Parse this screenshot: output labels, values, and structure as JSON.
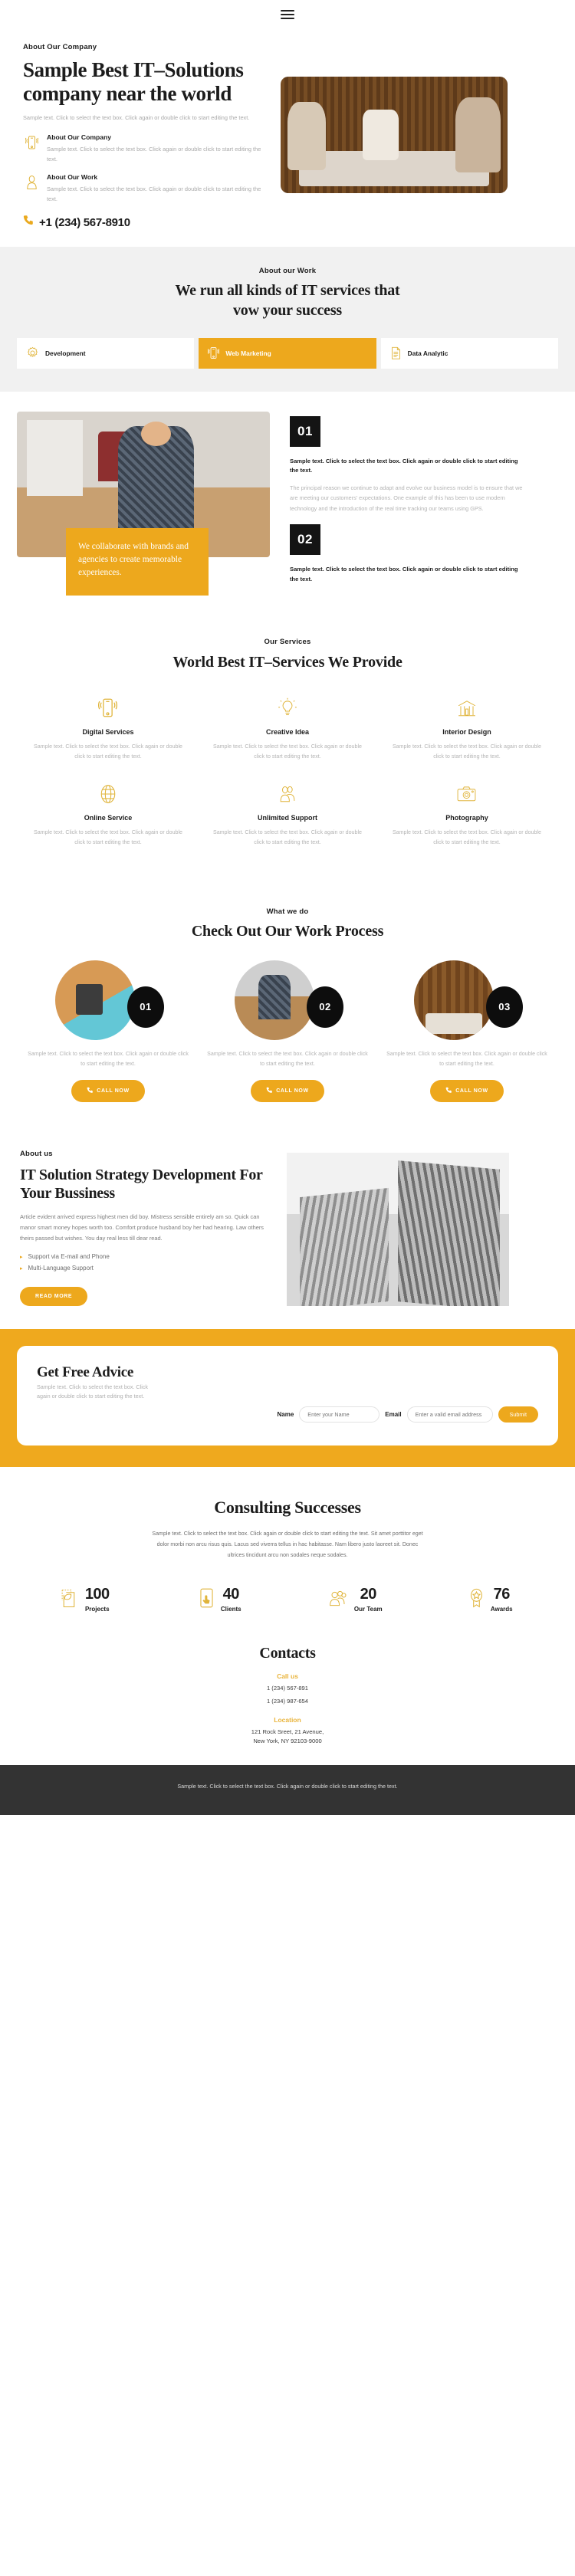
{
  "header": {
    "menu_icon": "hamburger-menu-icon"
  },
  "hero": {
    "eyebrow": "About Our Company",
    "title": "Sample Best IT–Solutions company near the world",
    "paragraph": "Sample text. Click to select the text box. Click again or double click to start editing the text.",
    "features": [
      {
        "icon": "mobile-signal-icon",
        "title": "About Our Company",
        "text": "Sample text. Click to select the text box. Click again or double click to start editing the text."
      },
      {
        "icon": "person-icon",
        "title": "About Our Work",
        "text": "Sample text. Click to select the text box. Click again or double click to start editing the text."
      }
    ],
    "phone_icon": "phone-icon",
    "phone": "+1 (234) 567-8910",
    "image_alt": "business-meeting-photo"
  },
  "work": {
    "eyebrow": "About our Work",
    "title": "We run all kinds of IT services that vow your success",
    "tabs": [
      {
        "label": "Development",
        "icon": "gear-icon",
        "active": false
      },
      {
        "label": "Web Marketing",
        "icon": "mobile-signal-icon",
        "active": true
      },
      {
        "label": "Data Analytic",
        "icon": "document-icon",
        "active": false
      }
    ],
    "active_color": "#eda81d"
  },
  "split": {
    "image_alt": "man-thinking-at-desk-photo",
    "callout": "We collaborate with brands and agencies to create memorable experiences.",
    "callout_bg": "#eda81d",
    "blocks": [
      {
        "number": "01",
        "bold": "Sample text. Click to select the text box. Click again or double click to start editing the text.",
        "body": "The principal reason we continue to adapt and evolve our business model is to ensure that we are meeting our customers’ expectations. One example of this has been to use modern technology and the introduction of the real time tracking our teams using GPS."
      },
      {
        "number": "02",
        "bold": "Sample text. Click to select the text box. Click again or double click to start editing the text.",
        "body": ""
      }
    ]
  },
  "services": {
    "eyebrow": "Our Services",
    "title": "World Best IT–Services We Provide",
    "items": [
      {
        "icon": "mobile-signal-icon",
        "title": "Digital Services",
        "text": "Sample text. Click to select the text box. Click again or double click to start editing the text."
      },
      {
        "icon": "lightbulb-icon",
        "title": "Creative Idea",
        "text": "Sample text. Click to select the text box. Click again or double click to start editing the text."
      },
      {
        "icon": "building-icon",
        "title": "Interior Design",
        "text": "Sample text. Click to select the text box. Click again or double click to start editing the text."
      },
      {
        "icon": "globe-icon",
        "title": "Online Service",
        "text": "Sample text. Click to select the text box. Click again or double click to start editing the text."
      },
      {
        "icon": "people-icon",
        "title": "Unlimited Support",
        "text": "Sample text. Click to select the text box. Click again or double click to start editing the text."
      },
      {
        "icon": "camera-icon",
        "title": "Photography",
        "text": "Sample text. Click to select the text box. Click again or double click to start editing the text."
      }
    ]
  },
  "process": {
    "eyebrow": "What we do",
    "title": "Check Out Our Work Process",
    "steps": [
      {
        "number": "01",
        "image_alt": "calculator-desk-photo",
        "text": "Sample text. Click to select the text box. Click again or double click to start editing the text.",
        "button": "CALL NOW",
        "button_icon": "phone-icon"
      },
      {
        "number": "02",
        "image_alt": "man-with-laptop-photo",
        "text": "Sample text. Click to select the text box. Click again or double click to start editing the text.",
        "button": "CALL NOW",
        "button_icon": "phone-icon"
      },
      {
        "number": "03",
        "image_alt": "office-meeting-photo",
        "text": "Sample text. Click to select the text box. Click again or double click to start editing the text.",
        "button": "CALL NOW",
        "button_icon": "phone-icon"
      }
    ]
  },
  "about": {
    "eyebrow": "About us",
    "title": "IT Solution Strategy Development For Your Bussiness",
    "paragraph": "Article evident arrived express highest men did boy. Mistress sensible entirely am so. Quick can manor smart money hopes worth too. Comfort produce husband boy her had hearing. Law others theirs passed but wishes. You day real less till dear read.",
    "bullets": [
      "Support via E-mail and Phone",
      "Multi-Language Support"
    ],
    "button": "READ MORE",
    "image_alt": "grayscale-skyscraper-photo"
  },
  "advice": {
    "band_bg": "#efa91e",
    "title": "Get Free Advice",
    "subtitle": "Sample text. Click to select the text box. Click again or double click to start editing the text.",
    "name_label": "Name",
    "name_placeholder": "Enter your Name",
    "email_label": "Email",
    "email_placeholder": "Enter a valid email address",
    "submit_label": "Submit"
  },
  "consulting": {
    "title": "Consulting Successes",
    "paragraph": "Sample text. Click to select the text box. Click again or double click to start editing the text. Sit amet porttitor eget dolor morbi non arcu risus quis. Lacus sed viverra tellus in hac habitasse. Nam libero justo laoreet sit. Donec ultrices tincidunt arcu non sodales neque sodales.",
    "stats": [
      {
        "icon": "document-leaf-icon",
        "value": "100",
        "label": "Projects"
      },
      {
        "icon": "mobile-tap-icon",
        "value": "40",
        "label": "Clients"
      },
      {
        "icon": "people-group-icon",
        "value": "20",
        "label": "Our Team"
      },
      {
        "icon": "award-badge-icon",
        "value": "76",
        "label": "Awards"
      }
    ]
  },
  "contacts": {
    "title": "Contacts",
    "call_heading": "Call us",
    "phone1": "1 (234) 567-891",
    "phone2": "1 (234) 987-654",
    "location_heading": "Location",
    "address_line1": "121 Rock Sreet, 21 Avenue,",
    "address_line2": "New York, NY 92103-9000",
    "accent": "#e9b43c"
  },
  "footer": {
    "text": "Sample text. Click to select the text box. Click again or double click to start editing the text.",
    "bg": "#333333"
  }
}
